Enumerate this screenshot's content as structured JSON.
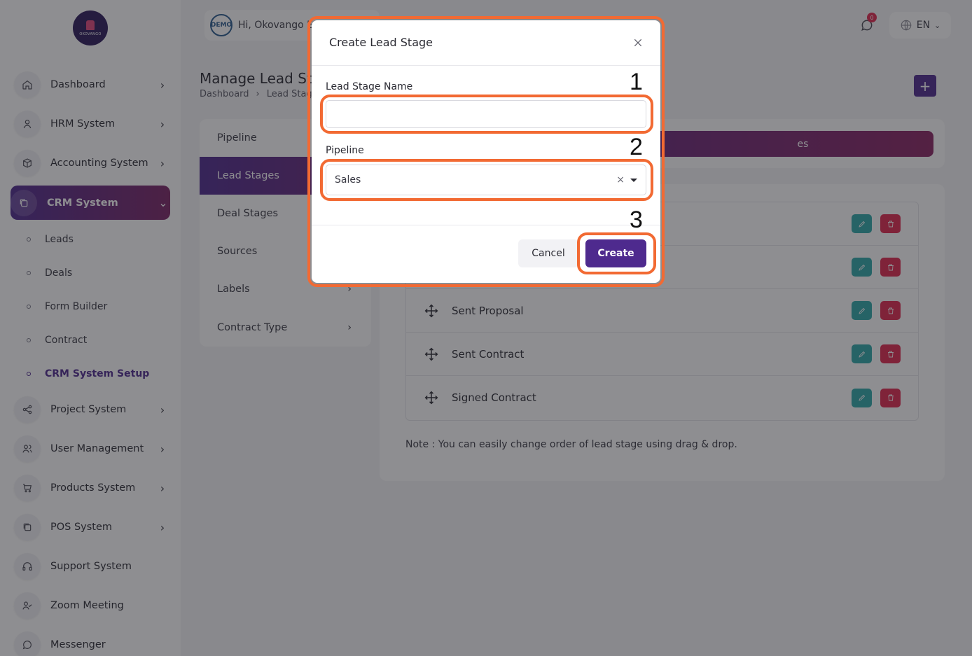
{
  "sidebar": {
    "logo_text": "OKOVANGO",
    "items": [
      {
        "label": "Dashboard",
        "icon": "home-icon"
      },
      {
        "label": "HRM System",
        "icon": "user-icon"
      },
      {
        "label": "Accounting System",
        "icon": "box-icon"
      },
      {
        "label": "CRM System",
        "icon": "layers-icon"
      },
      {
        "label": "Project System",
        "icon": "share-icon"
      },
      {
        "label": "User Management",
        "icon": "users-icon"
      },
      {
        "label": "Products System",
        "icon": "cart-icon"
      },
      {
        "label": "POS System",
        "icon": "layers-icon"
      },
      {
        "label": "Support System",
        "icon": "headphones-icon"
      },
      {
        "label": "Zoom Meeting",
        "icon": "user-check-icon"
      },
      {
        "label": "Messenger",
        "icon": "chat-icon"
      }
    ],
    "crm_sub": [
      "Leads",
      "Deals",
      "Form Builder",
      "Contract",
      "CRM System Setup"
    ]
  },
  "header": {
    "demo_badge": "DEMO",
    "greeting": "Hi, Okovango Ea",
    "notification_count": "0",
    "language": "EN"
  },
  "page": {
    "title": "Manage Lead Sta",
    "breadcrumb": [
      "Dashboard",
      "Lead Stag"
    ],
    "add_button": "+"
  },
  "settings_menu": [
    "Pipeline",
    "Lead Stages",
    "Deal Stages",
    "Sources",
    "Labels",
    "Contract Type"
  ],
  "tab_active_fragment": "es",
  "stages": [
    "Sent Proposal",
    "Sent Contract",
    "Signed Contract"
  ],
  "note": "Note : You can easily change order of lead stage using drag & drop.",
  "modal": {
    "title": "Create Lead Stage",
    "name_label": "Lead Stage Name",
    "name_value": "",
    "pipeline_label": "Pipeline",
    "pipeline_value": "Sales",
    "clear_glyph": "×",
    "cancel": "Cancel",
    "create": "Create"
  },
  "callouts": [
    "1",
    "2",
    "3"
  ],
  "colors": {
    "brand": "#4e2a8e",
    "accent_gradient_end": "#8a2462",
    "edit": "#2fa8a8",
    "delete": "#e0284e",
    "callout": "#f26a33"
  }
}
